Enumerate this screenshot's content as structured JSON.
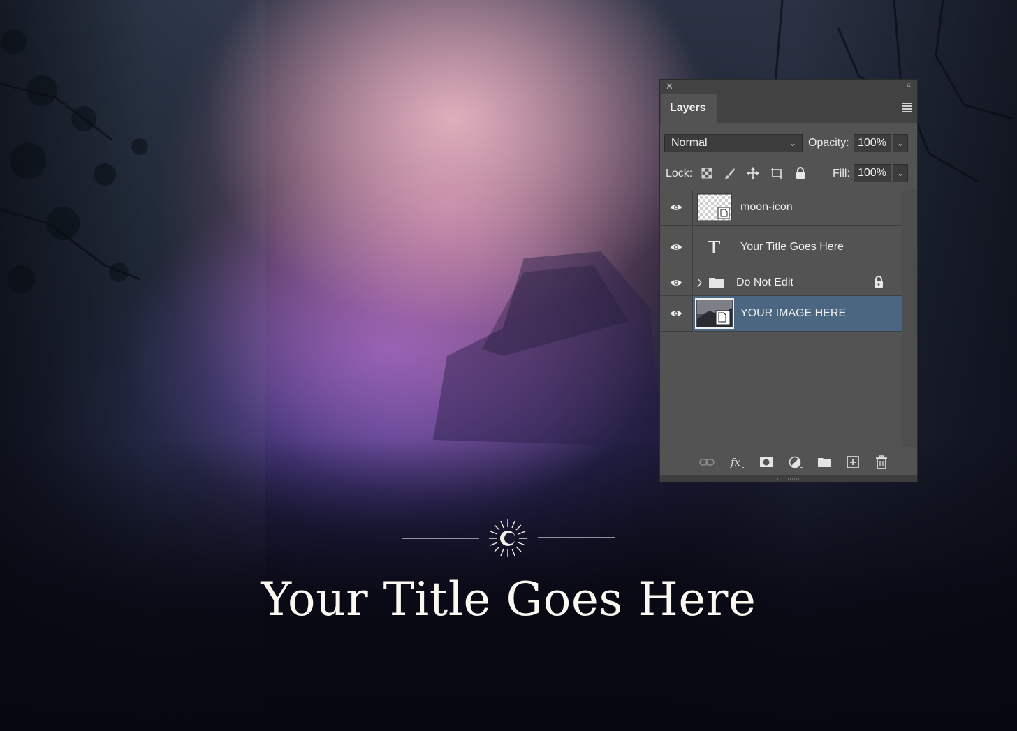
{
  "poster": {
    "title": "Your Title Goes Here",
    "emblem_icon": "sun-moon-icon"
  },
  "layers_panel": {
    "tab_label": "Layers",
    "blend_mode": "Normal",
    "opacity_label": "Opacity:",
    "opacity_value": "100%",
    "lock_label": "Lock:",
    "fill_label": "Fill:",
    "fill_value": "100%",
    "lock_icons": [
      "lock-transparent-pixels-icon",
      "lock-image-pixels-icon",
      "lock-position-icon",
      "lock-artboard-icon",
      "lock-all-icon"
    ],
    "layers": [
      {
        "name": "moon-icon",
        "kind": "smart-object",
        "visible": true,
        "selected": false
      },
      {
        "name": "Your Title Goes Here",
        "kind": "text",
        "visible": true,
        "selected": false
      },
      {
        "name": "Do Not Edit",
        "kind": "group",
        "visible": true,
        "locked": true,
        "selected": false
      },
      {
        "name": "YOUR IMAGE HERE",
        "kind": "smart-object",
        "visible": true,
        "selected": true
      }
    ],
    "footer_icons": [
      "link-layers-icon",
      "fx-icon",
      "add-mask-icon",
      "adjustment-layer-icon",
      "new-group-icon",
      "new-layer-icon",
      "delete-layer-icon"
    ],
    "colors": {
      "panel_bg": "#535353",
      "selected_row": "#4b6681",
      "field_bg": "#3c3c3c"
    }
  }
}
